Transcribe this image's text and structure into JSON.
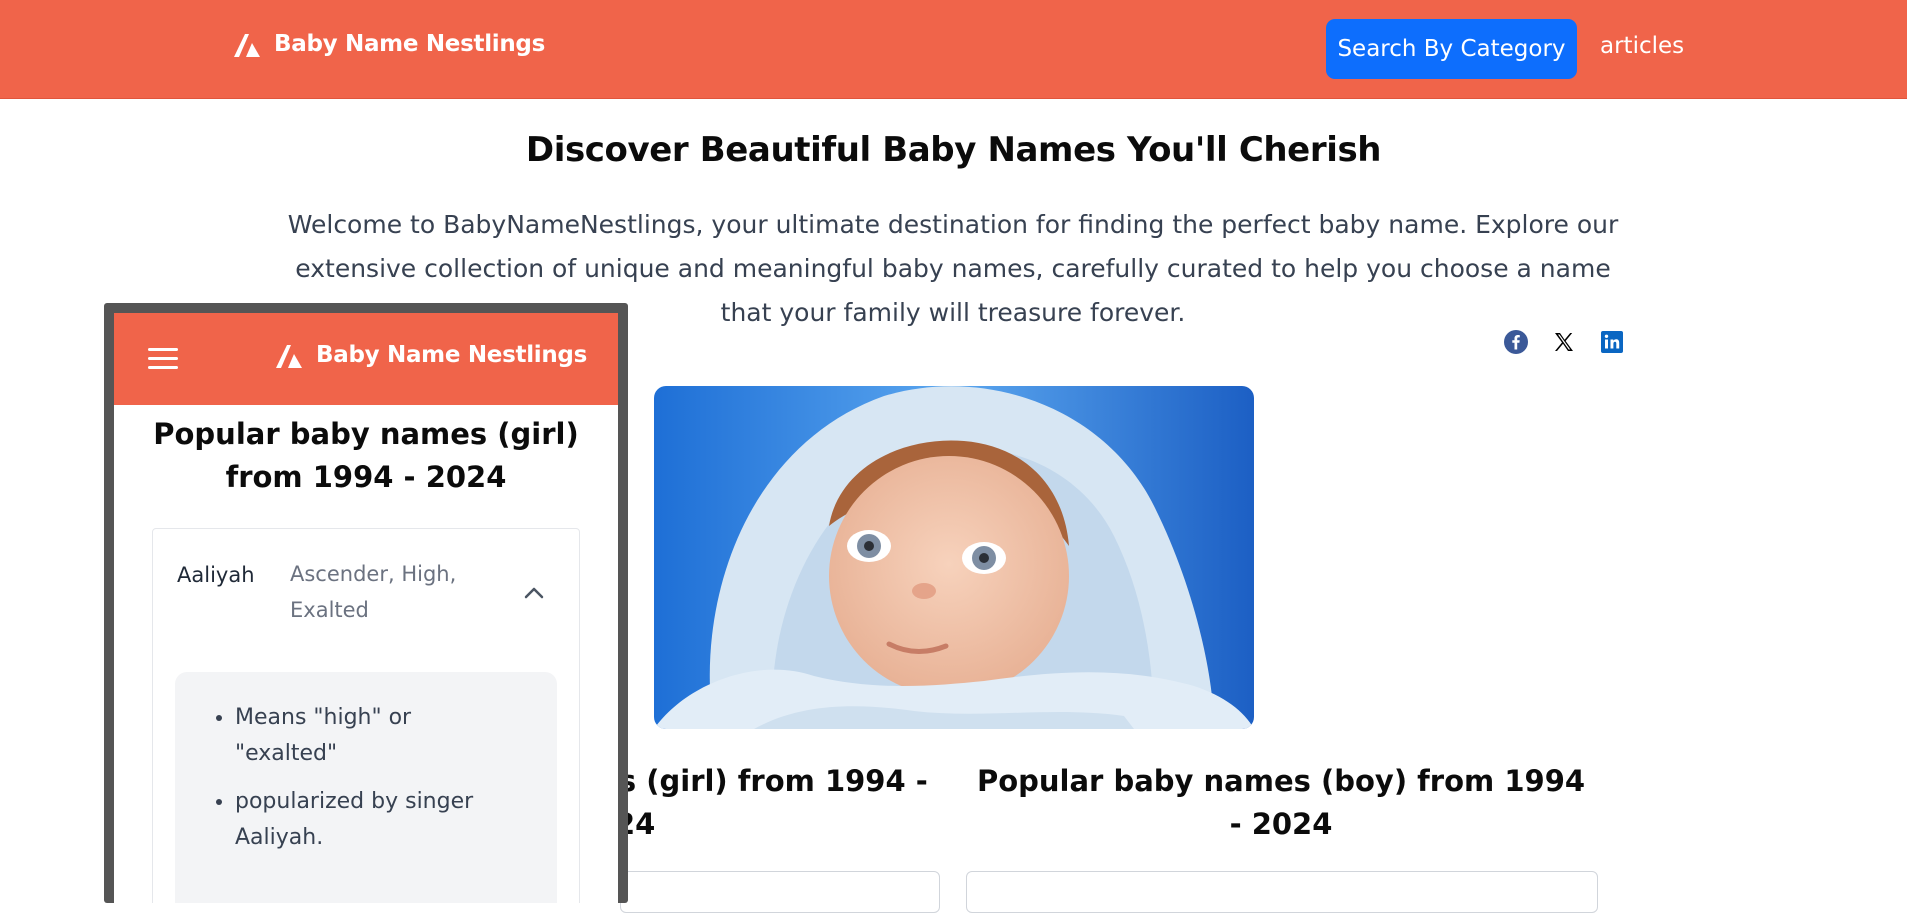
{
  "header": {
    "brand": "Baby Name Nestlings",
    "search_button": "Search By Category",
    "articles_link": "articles",
    "colors": {
      "bar": "#f0644a",
      "button": "#0d6efd"
    }
  },
  "hero": {
    "title": "Discover Beautiful Baby Names You'll Cherish",
    "text": "Welcome to BabyNameNestlings, your ultimate destination for finding the perfect baby name. Explore our extensive collection of unique and meaningful baby names, carefully curated to help you choose a name that your family will treasure forever.",
    "share_icons": [
      "facebook-icon",
      "x-icon",
      "linkedin-icon"
    ],
    "image": "smiling-baby-in-blue-towel"
  },
  "sections": {
    "girl_title": "Popular baby names (girl) from 1994 - 2024",
    "boy_title": "Popular baby names (boy) from 1994 - 2024"
  },
  "mobile": {
    "brand": "Baby Name Nestlings",
    "menu_icon": "hamburger-icon",
    "title": "Popular baby names (girl) from 1994 - 2024",
    "first_item": {
      "name": "Aaliyah",
      "meaning": "Ascender, High, Exalted",
      "expanded": true,
      "details": [
        "Means \"high\" or \"exalted\"",
        "popularized by singer Aaliyah."
      ]
    }
  }
}
